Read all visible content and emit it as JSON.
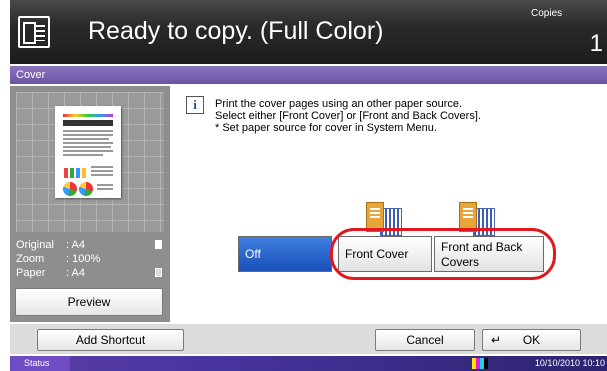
{
  "header": {
    "title": "Ready to copy. (Full Color)",
    "copies_label": "Copies",
    "copies_value": "1"
  },
  "screen_title": "Cover",
  "preview": {
    "original_label": "Original",
    "original_value": ": A4",
    "zoom_label": "Zoom",
    "zoom_value": ": 100%",
    "paper_label": "Paper",
    "paper_value": ": A4",
    "preview_button": "Preview"
  },
  "message": {
    "line1": "Print the cover pages using an other paper source.",
    "line2": "Select either [Front Cover] or [Front and Back Covers].",
    "line3": "* Set paper source for cover in System Menu."
  },
  "options": {
    "off": "Off",
    "front_cover": "Front Cover",
    "front_back_line1": "Front and Back",
    "front_back_line2": "Covers",
    "selected": "Off"
  },
  "footer": {
    "add_shortcut": "Add Shortcut",
    "cancel": "Cancel",
    "ok": "OK"
  },
  "status": {
    "label": "Status",
    "datetime": "10/10/2010 10:10"
  },
  "colors": {
    "accent": "#6b55a3",
    "selected_blue": "#1a4fb8",
    "highlight_red": "#e01820"
  }
}
